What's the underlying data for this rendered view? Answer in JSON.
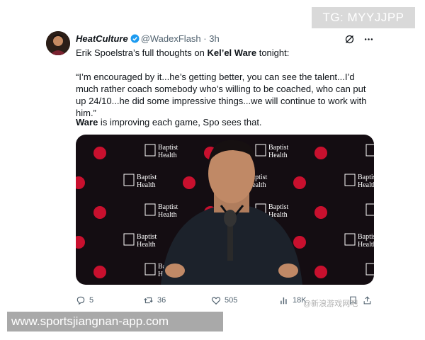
{
  "watermark_top": "TG: MYYJJPP",
  "watermark_bottom": "www.sportsjiangnan-app.com",
  "watermark_faint": "@新浪游戏网吧",
  "tweet": {
    "display_name": "HeatCulture",
    "handle": "@WadexFlash",
    "separator": "·",
    "time": "3h",
    "line1_pre": "Erik Spoelstra’s full thoughts on ",
    "line1_bold": "Kel’el Ware",
    "line1_post": " tonight:",
    "quote": "“I’m encouraged by it...he’s getting better, you can see the talent...I’d much rather coach somebody who’s willing to be coached, who can put up 24/10...he did some impressive things...we will continue to work with him.”",
    "line3_bold": "Ware",
    "line3_post": " is improving each game, Spo sees that.",
    "backdrop_text": [
      "Baptist",
      "Health"
    ]
  },
  "actions": {
    "replies": "5",
    "retweets": "36",
    "likes": "505",
    "views": "18K"
  },
  "colors": {
    "verified": "#1d9bf0",
    "muted": "#536471",
    "backdrop": "#140d12",
    "heat_red": "#c8102e"
  }
}
